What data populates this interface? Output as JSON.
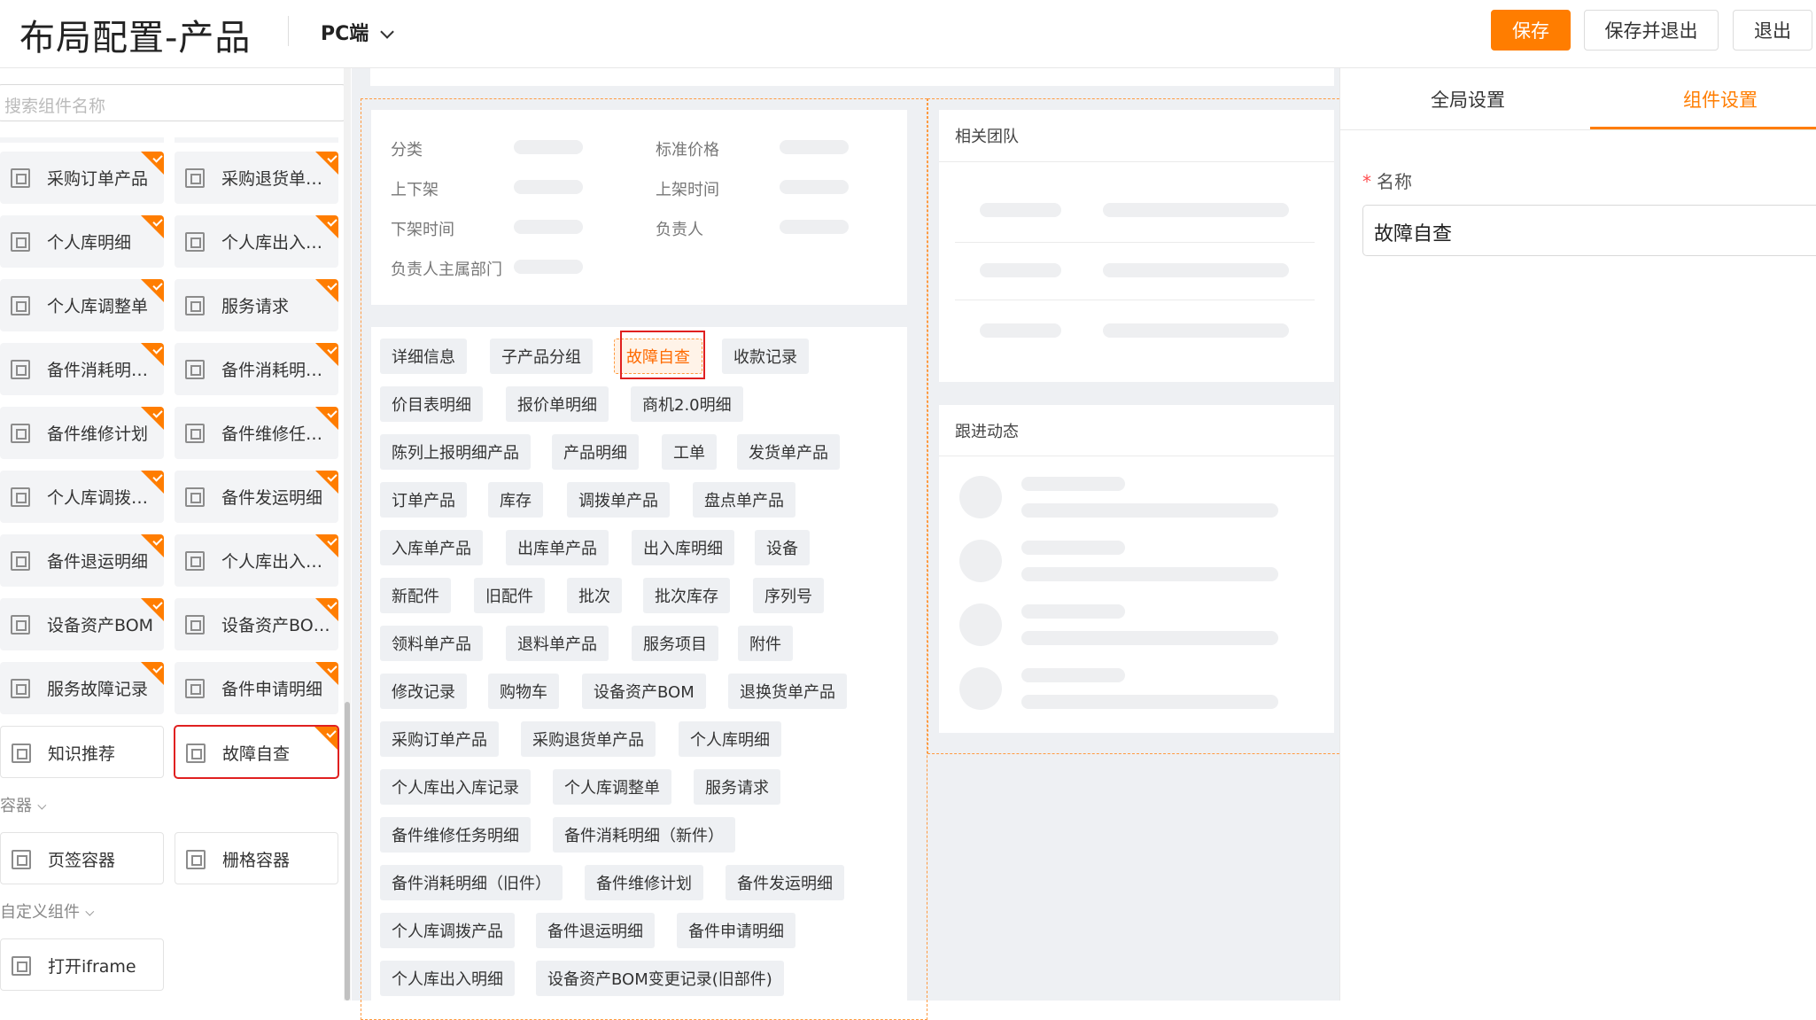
{
  "header": {
    "title": "布局配置-产品",
    "platform": "PC端",
    "save_label": "保存",
    "save_exit_label": "保存并退出",
    "exit_label": "退出"
  },
  "sidebar": {
    "search_placeholder": "搜索组件名称",
    "business_components": [
      {
        "label": "采购订单产品"
      },
      {
        "label": "采购退货单产品"
      },
      {
        "label": "个人库明细"
      },
      {
        "label": "个人库出入库记录"
      },
      {
        "label": "个人库调整单"
      },
      {
        "label": "服务请求"
      },
      {
        "label": "备件消耗明细（新件）"
      },
      {
        "label": "备件消耗明细（旧件）"
      },
      {
        "label": "备件维修计划"
      },
      {
        "label": "备件维修任务明细"
      },
      {
        "label": "个人库调拨产品"
      },
      {
        "label": "备件发运明细"
      },
      {
        "label": "备件退运明细"
      },
      {
        "label": "个人库出入明细"
      },
      {
        "label": "设备资产BOM"
      },
      {
        "label": "设备资产BOM变更记录"
      },
      {
        "label": "服务故障记录"
      },
      {
        "label": "备件申请明细"
      },
      {
        "label": "知识推荐"
      },
      {
        "label": "故障自查"
      }
    ],
    "container_section": "容器",
    "containers": [
      {
        "label": "页签容器"
      },
      {
        "label": "栅格容器"
      }
    ],
    "custom_section": "自定义组件",
    "custom": [
      {
        "label": "打开iframe"
      }
    ]
  },
  "canvas": {
    "info_fields": [
      {
        "label": "分类"
      },
      {
        "label": "标准价格"
      },
      {
        "label": "上下架"
      },
      {
        "label": "上架时间"
      },
      {
        "label": "下架时间"
      },
      {
        "label": "负责人"
      },
      {
        "label": "负责人主属部门"
      }
    ],
    "tabs": [
      "详细信息",
      "子产品分组",
      "故障自查",
      "收款记录",
      "价目表明细",
      "报价单明细",
      "商机2.0明细",
      "陈列上报明细产品",
      "产品明细",
      "工单",
      "发货单产品",
      "订单产品",
      "库存",
      "调拨单产品",
      "盘点单产品",
      "入库单产品",
      "出库单产品",
      "出入库明细",
      "设备",
      "新配件",
      "旧配件",
      "批次",
      "批次库存",
      "序列号",
      "领料单产品",
      "退料单产品",
      "服务项目",
      "附件",
      "修改记录",
      "购物车",
      "设备资产BOM",
      "退换货单产品",
      "采购订单产品",
      "采购退货单产品",
      "个人库明细",
      "个人库出入库记录",
      "个人库调整单",
      "服务请求",
      "备件维修任务明细",
      "备件消耗明细（新件）",
      "备件消耗明细（旧件）",
      "备件维修计划",
      "备件发运明细",
      "个人库调拨产品",
      "备件退运明细",
      "备件申请明细",
      "个人库出入明细",
      "设备资产BOM变更记录(旧部件)"
    ],
    "related_team_title": "相关团队",
    "follow_up_title": "跟进动态"
  },
  "rightpanel": {
    "tab_global": "全局设置",
    "tab_component": "组件设置",
    "name_label": "名称",
    "name_value": "故障自查"
  },
  "colors": {
    "accent": "#ff7d00",
    "highlight_border": "#e02020"
  }
}
